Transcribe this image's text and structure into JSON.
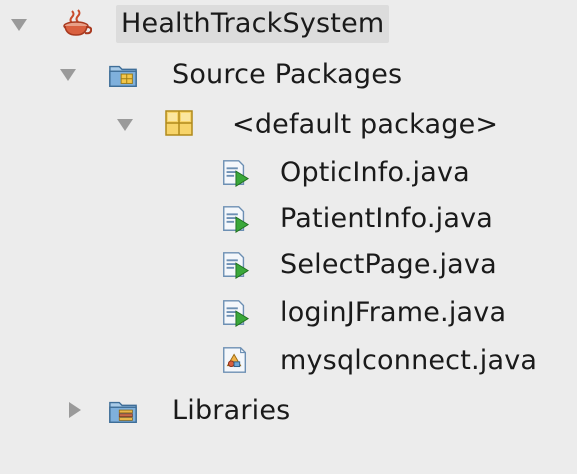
{
  "tree": {
    "project": {
      "label": "HealthTrackSystem",
      "icon": "coffee-cup-project-icon",
      "expanded": true,
      "selected": true
    },
    "source_packages": {
      "label": "Source Packages",
      "icon": "source-folder-icon",
      "expanded": true
    },
    "default_package": {
      "label": "<default package>",
      "icon": "package-icon",
      "expanded": true
    },
    "files": [
      {
        "label": "OpticInfo.java",
        "icon": "java-runnable-file-icon"
      },
      {
        "label": "PatientInfo.java",
        "icon": "java-runnable-file-icon"
      },
      {
        "label": "SelectPage.java",
        "icon": "java-runnable-file-icon"
      },
      {
        "label": "loginJFrame.java",
        "icon": "java-runnable-file-icon"
      },
      {
        "label": "mysqlconnect.java",
        "icon": "java-class-file-icon"
      }
    ],
    "libraries": {
      "label": "Libraries",
      "icon": "libraries-folder-icon",
      "expanded": false
    }
  },
  "colors": {
    "background": "#ececec",
    "selection": "#dcdcdc",
    "toggle": "#9a9a9a",
    "folder_blue": "#6fa8d8",
    "package_yellow": "#f0c040",
    "run_green": "#3aa83a"
  }
}
